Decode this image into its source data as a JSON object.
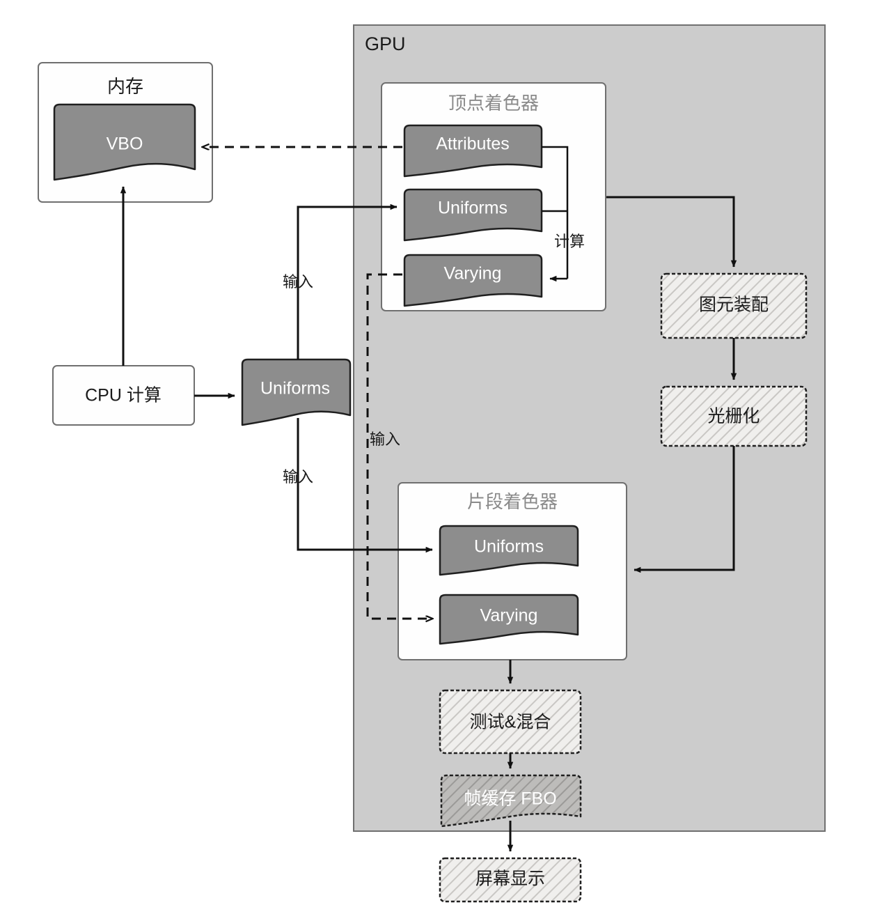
{
  "diagram": {
    "title_gpu": "GPU",
    "containers": {
      "memory": "内存",
      "vertex_shader": "顶点着色器",
      "fragment_shader": "片段着色器"
    },
    "nodes": {
      "vbo": "VBO",
      "cpu": "CPU 计算",
      "uniforms_cpu": "Uniforms",
      "vs_attributes": "Attributes",
      "vs_uniforms": "Uniforms",
      "vs_varying": "Varying",
      "fs_uniforms": "Uniforms",
      "fs_varying": "Varying",
      "primitive_assembly": "图元装配",
      "rasterization": "光栅化",
      "test_blend": "测试&混合",
      "framebuffer": "帧缓存 FBO",
      "screen": "屏幕显示"
    },
    "edge_labels": {
      "compute": "计算",
      "input_uniform_vs": "输入",
      "input_uniform_fs": "输入",
      "input_varying": "输入"
    },
    "colors": {
      "gpu_fill": "#cccccc",
      "data_fill": "#8d8d8d",
      "box_fill": "#fefefe",
      "stroke": "#1f1f1f",
      "title_muted": "#8a8a8a"
    }
  }
}
